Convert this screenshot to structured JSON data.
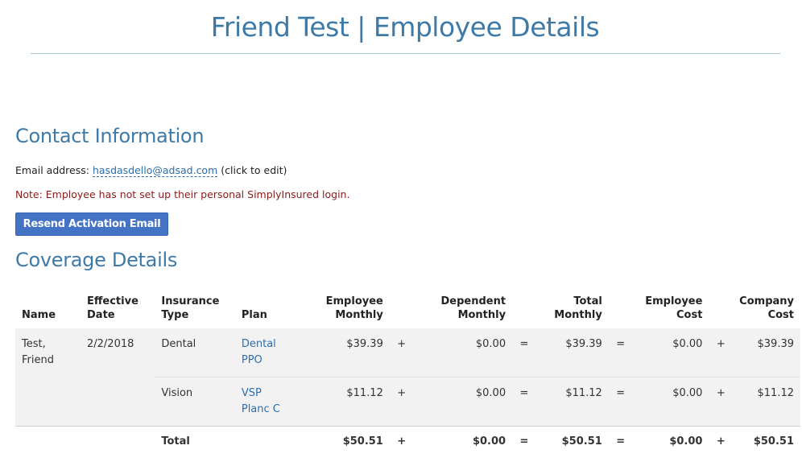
{
  "header": {
    "title": "Friend Test | Employee Details"
  },
  "contact": {
    "heading": "Contact Information",
    "email_label": "Email address:",
    "email_value": "hasdasdello@adsad.com",
    "email_hint": "(click to edit)",
    "note": "Note: Employee has not set up their personal SimplyInsured login.",
    "resend_label": "Resend Activation Email"
  },
  "coverage": {
    "heading": "Coverage Details",
    "columns": {
      "name": "Name",
      "effective_date_1": "Effective",
      "effective_date_2": "Date",
      "insurance_type_1": "Insurance",
      "insurance_type_2": "Type",
      "plan": "Plan",
      "employee_monthly_1": "Employee",
      "employee_monthly_2": "Monthly",
      "dependent_monthly_1": "Dependent",
      "dependent_monthly_2": "Monthly",
      "total_monthly_1": "Total",
      "total_monthly_2": "Monthly",
      "employee_cost_1": "Employee",
      "employee_cost_2": "Cost",
      "company_cost_1": "Company",
      "company_cost_2": "Cost"
    },
    "operators": {
      "plus": "+",
      "equals": "="
    },
    "employee": {
      "name_1": "Test,",
      "name_2": "Friend",
      "effective_date": "2/2/2018"
    },
    "rows": [
      {
        "insurance_type": "Dental",
        "plan_1": "Dental",
        "plan_2": "PPO",
        "employee_monthly": "$39.39",
        "dependent_monthly": "$0.00",
        "total_monthly": "$39.39",
        "employee_cost": "$0.00",
        "company_cost": "$39.39"
      },
      {
        "insurance_type": "Vision",
        "plan_1": "VSP",
        "plan_2": "Planc C",
        "employee_monthly": "$11.12",
        "dependent_monthly": "$0.00",
        "total_monthly": "$11.12",
        "employee_cost": "$0.00",
        "company_cost": "$11.12"
      }
    ],
    "total": {
      "label": "Total",
      "employee_monthly": "$50.51",
      "dependent_monthly": "$0.00",
      "total_monthly": "$50.51",
      "employee_cost": "$0.00",
      "company_cost": "$50.51"
    }
  },
  "colors": {
    "heading": "#3e7aa8",
    "link": "#2a6eb0",
    "note": "#8b1a1a",
    "button": "#4472c4",
    "row_shade": "#f2f2f2"
  }
}
